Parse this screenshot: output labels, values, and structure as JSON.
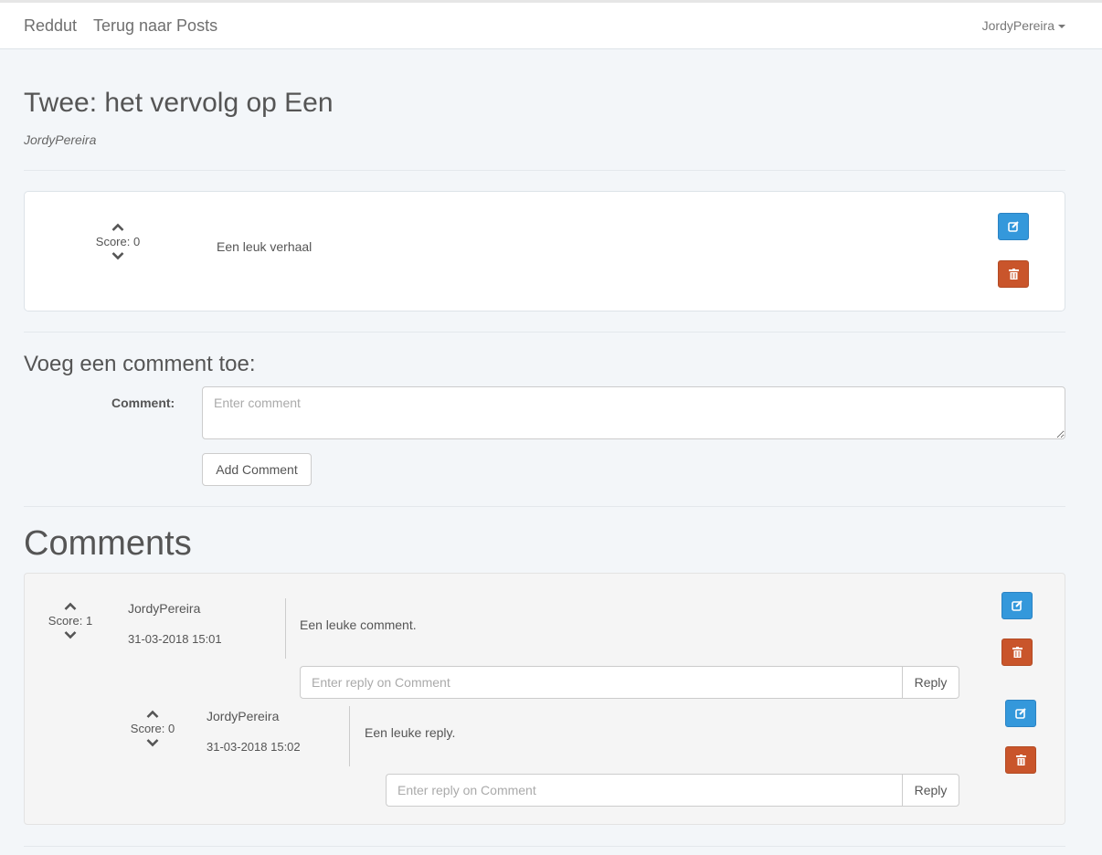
{
  "nav": {
    "brand": "Reddut",
    "back_link": "Terug naar Posts",
    "user": "JordyPereira"
  },
  "post": {
    "title": "Twee: het vervolg op Een",
    "author": "JordyPereira",
    "score_text": "Score: 0",
    "body": "Een leuk verhaal"
  },
  "add_comment": {
    "heading": "Voeg een comment toe:",
    "label": "Comment:",
    "placeholder": "Enter comment",
    "button": "Add Comment"
  },
  "comments_heading": "Comments",
  "comments": [
    {
      "author": "JordyPereira",
      "date": "31-03-2018 15:01",
      "score_text": "Score: 1",
      "body": "Een leuke comment.",
      "reply_placeholder": "Enter reply on Comment",
      "reply_button": "Reply"
    },
    {
      "author": "JordyPereira",
      "date": "31-03-2018 15:02",
      "score_text": "Score: 0",
      "body": "Een leuke reply.",
      "reply_placeholder": "Enter reply on Comment",
      "reply_button": "Reply"
    }
  ],
  "icons": {
    "upvote": "chevron-up-icon",
    "downvote": "chevron-down-icon",
    "edit": "edit-icon",
    "delete": "trash-icon"
  },
  "colors": {
    "edit_button": "#3498db",
    "delete_button": "#c9552b",
    "background": "#f3f6f9"
  }
}
